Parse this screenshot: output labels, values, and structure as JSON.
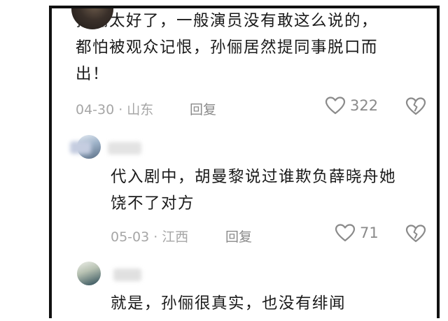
{
  "comments": [
    {
      "text_lines": [
        "孙俪太好了，一般演员没有敢这么说的，",
        "都怕被观众记恨，孙俪居然提同事脱口而",
        "出！"
      ],
      "date": "04-30",
      "location": "山东",
      "reply_label": "回复",
      "likes": "322"
    },
    {
      "text_lines": [
        "代入剧中，胡曼黎说过谁欺负薛晓舟她",
        "饶不了对方"
      ],
      "date": "05-03",
      "location": "江西",
      "reply_label": "回复",
      "likes": "71"
    },
    {
      "text_lines": [
        "就是，孙俪很真实，也没有绯闻"
      ]
    }
  ],
  "separator": "·",
  "icons": {
    "like": "heart-outline-icon",
    "dislike": "broken-heart-icon"
  },
  "colors": {
    "text": "#1a1a1a",
    "meta": "#a6a6a6",
    "action": "#8a8a8a",
    "frame": "#111111"
  }
}
